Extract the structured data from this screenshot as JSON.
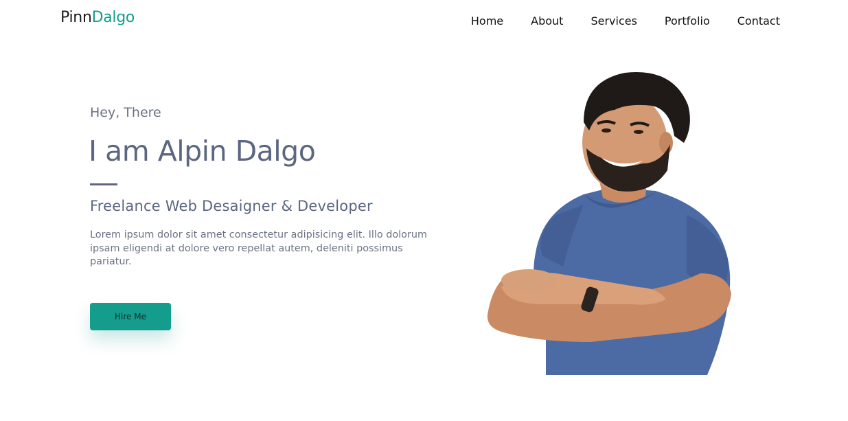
{
  "brand": {
    "first": "Pinn",
    "second": "Dalgo"
  },
  "nav": {
    "items": [
      {
        "label": "Home"
      },
      {
        "label": "About"
      },
      {
        "label": "Services"
      },
      {
        "label": "Portfolio"
      },
      {
        "label": "Contact"
      }
    ]
  },
  "hero": {
    "greeting": "Hey, There",
    "headline": "I am Alpin Dalgo",
    "subtitle": "Freelance Web Desaigner & Developer",
    "description": "Lorem ipsum dolor sit amet consectetur adipisicing elit. Illo dolorum ipsam eligendi at dolore vero repellat autem, deleniti possimus pariatur.",
    "cta_label": "Hire Me"
  },
  "colors": {
    "accent": "#149c8c",
    "text_primary": "#5b6680",
    "nav_text": "#111111"
  }
}
